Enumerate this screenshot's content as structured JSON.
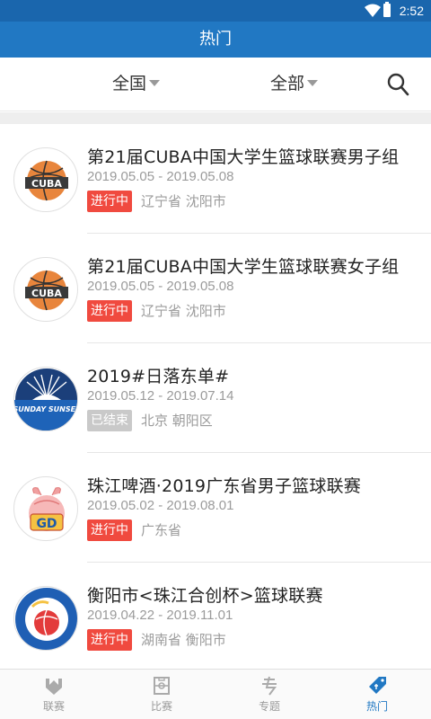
{
  "status_bar": {
    "time": "2:52"
  },
  "app_bar": {
    "title": "热门"
  },
  "filters": {
    "region": "全国",
    "category": "全部"
  },
  "events": [
    {
      "title": "第21届CUBA中国大学生篮球联赛男子组",
      "dates": "2019.05.05 - 2019.05.08",
      "status": "进行中",
      "location": "辽宁省 沈阳市",
      "logo_text": "CUBA"
    },
    {
      "title": "第21届CUBA中国大学生篮球联赛女子组",
      "dates": "2019.05.05 - 2019.05.08",
      "status": "进行中",
      "location": "辽宁省 沈阳市",
      "logo_text": "CUBA"
    },
    {
      "title": "2019#日落东单#",
      "dates": "2019.05.12 - 2019.07.14",
      "status": "已结束",
      "location": "北京 朝阳区",
      "logo_text": "SUNDAY SUNSET"
    },
    {
      "title": "珠江啤酒·2019广东省男子篮球联赛",
      "dates": "2019.05.02 - 2019.08.01",
      "status": "进行中",
      "location": "广东省",
      "logo_text": "GD"
    },
    {
      "title": "衡阳市<珠江合创杯>篮球联赛",
      "dates": "2019.04.22 - 2019.11.01",
      "status": "进行中",
      "location": "湖南省 衡阳市",
      "logo_text": ""
    }
  ],
  "tabs": [
    {
      "label": "联赛",
      "icon": "league-icon"
    },
    {
      "label": "比赛",
      "icon": "match-icon"
    },
    {
      "label": "专题",
      "icon": "topic-icon"
    },
    {
      "label": "热门",
      "icon": "hot-tag-icon",
      "active": true
    }
  ],
  "colors": {
    "status_bar": "#1a66ad",
    "app_bar": "#2178c3",
    "badge_ongoing": "#f04a3f",
    "badge_ended": "#c9c9c9",
    "tab_active": "#2178c3"
  }
}
